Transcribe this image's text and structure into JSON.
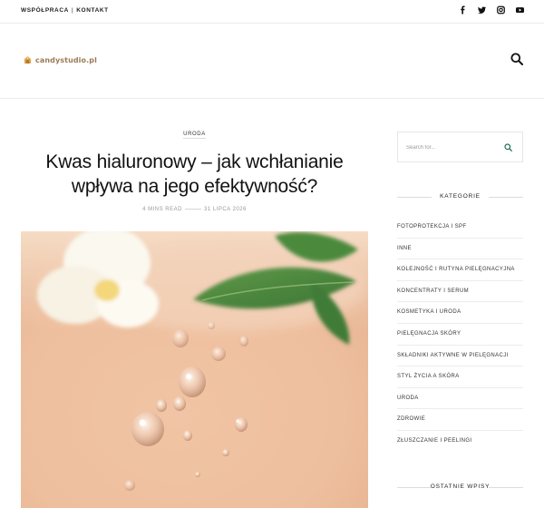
{
  "top_nav": {
    "link_1": "WSPÓŁPRACA",
    "separator": "|",
    "link_2": "KONTAKT"
  },
  "social_icons": [
    "facebook-icon",
    "twitter-icon",
    "instagram-icon",
    "youtube-icon"
  ],
  "logo": {
    "text": "candystudio.pl"
  },
  "article": {
    "category": "URODA",
    "title": "Kwas hialuronowy – jak wchłanianie wpływa na jego efektywność?",
    "read_time": "4 MINS READ",
    "date": "31 LIPCA 2026",
    "image_alt": "Krople serum na skórze z białym kwiatem i zielonymi liśćmi"
  },
  "sidebar": {
    "search_placeholder": "Search for...",
    "categories_title": "KATEGORIE",
    "categories": [
      "FOTOPROTEKCJA I SPF",
      "INNE",
      "KOLEJNOŚĆ I RUTYNA PIELĘGNACYJNA",
      "KONCENTRATY I SERUM",
      "KOSMETYKA I URODA",
      "PIELĘGNACJA SKÓRY",
      "SKŁADNIKI AKTYWNE W PIELĘGNACJI",
      "STYL ŻYCIA A SKÓRA",
      "URODA",
      "ZDROWIE",
      "ZŁUSZCZANIE I PEELINGI"
    ],
    "recent_title": "OSTATNIE WPISY"
  },
  "colors": {
    "logo_text": "#9c7a55",
    "search_icon": "#1f6d52",
    "divider": "#ececec"
  }
}
